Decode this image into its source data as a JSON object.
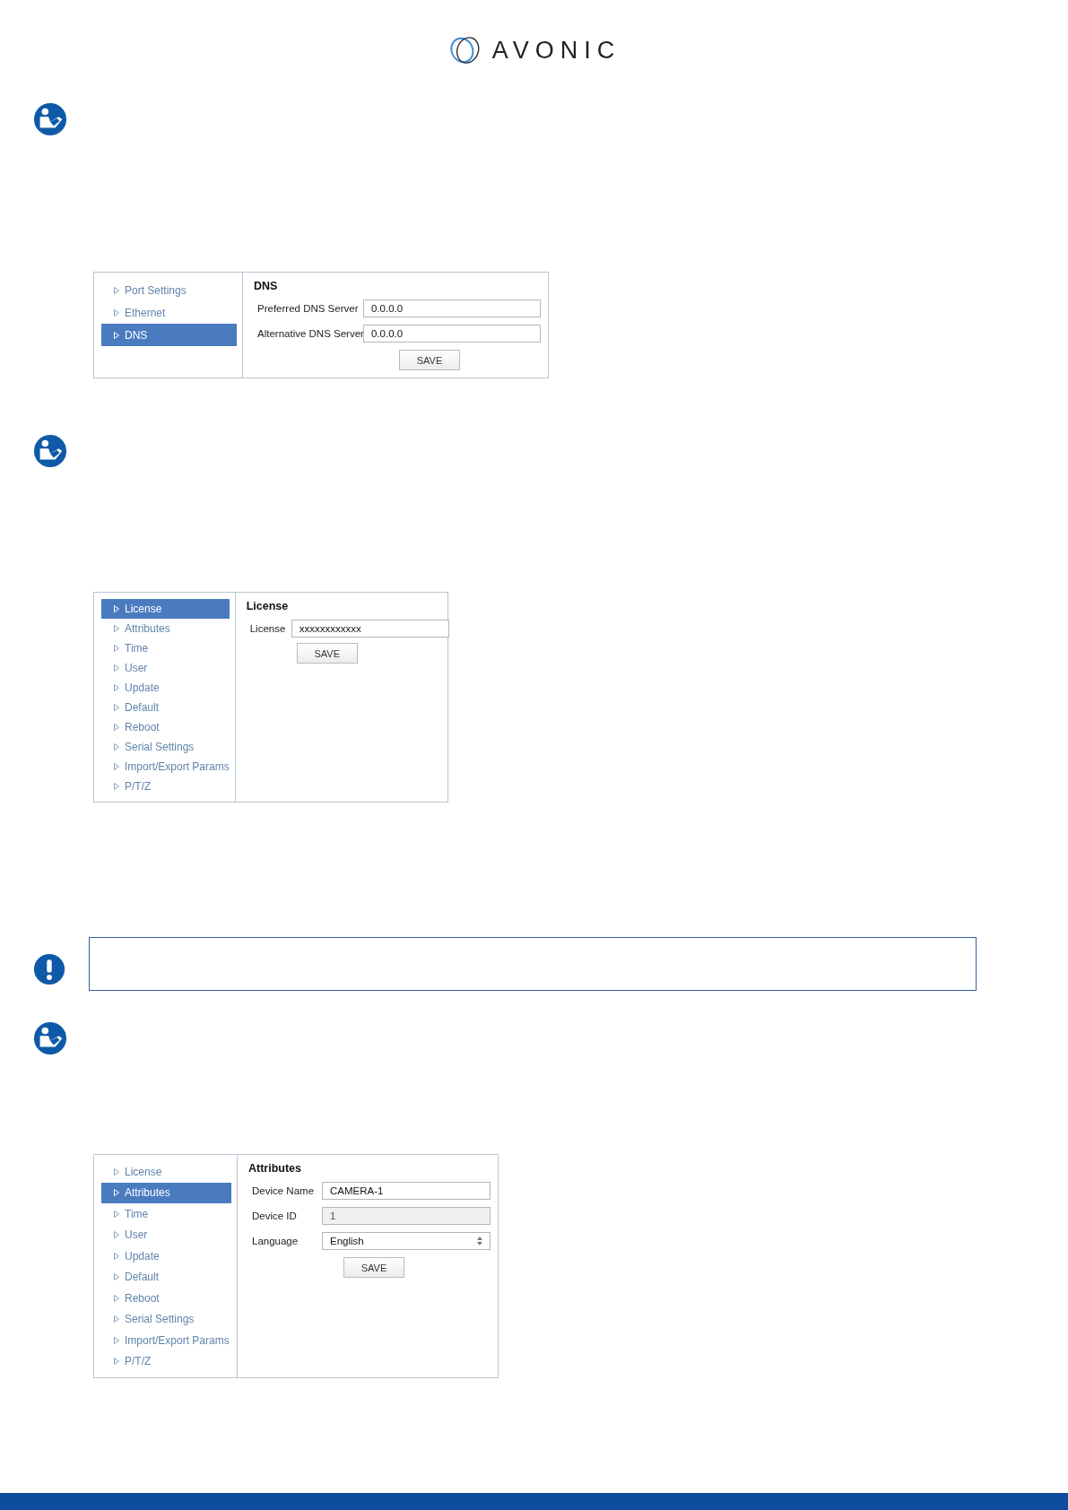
{
  "logo": {
    "text": "AVONIC"
  },
  "panels": [
    {
      "sidebar": [
        {
          "label": "Port Settings",
          "selected": false
        },
        {
          "label": "Ethernet",
          "selected": false
        },
        {
          "label": "DNS",
          "selected": true
        }
      ],
      "title": "DNS",
      "fields": [
        {
          "kind": "text",
          "label": "Preferred DNS Server",
          "value": "0.0.0.0"
        },
        {
          "kind": "text",
          "label": "Alternative DNS Server",
          "value": "0.0.0.0"
        }
      ],
      "button": "SAVE"
    },
    {
      "sidebar": [
        {
          "label": "License",
          "selected": true
        },
        {
          "label": "Attributes",
          "selected": false
        },
        {
          "label": "Time",
          "selected": false
        },
        {
          "label": "User",
          "selected": false
        },
        {
          "label": "Update",
          "selected": false
        },
        {
          "label": "Default",
          "selected": false
        },
        {
          "label": "Reboot",
          "selected": false
        },
        {
          "label": "Serial Settings",
          "selected": false
        },
        {
          "label": "Import/Export Params",
          "selected": false
        },
        {
          "label": "P/T/Z",
          "selected": false
        }
      ],
      "title": "License",
      "fields": [
        {
          "kind": "text",
          "label": "License",
          "value": "xxxxxxxxxxxx"
        }
      ],
      "button": "SAVE"
    },
    {
      "sidebar": [
        {
          "label": "License",
          "selected": false
        },
        {
          "label": "Attributes",
          "selected": true
        },
        {
          "label": "Time",
          "selected": false
        },
        {
          "label": "User",
          "selected": false
        },
        {
          "label": "Update",
          "selected": false
        },
        {
          "label": "Default",
          "selected": false
        },
        {
          "label": "Reboot",
          "selected": false
        },
        {
          "label": "Serial Settings",
          "selected": false
        },
        {
          "label": "Import/Export Params",
          "selected": false
        },
        {
          "label": "P/T/Z",
          "selected": false
        }
      ],
      "title": "Attributes",
      "fields": [
        {
          "kind": "text",
          "label": "Device Name",
          "value": "CAMERA-1"
        },
        {
          "kind": "readonly",
          "label": "Device ID",
          "value": "1"
        },
        {
          "kind": "select",
          "label": "Language",
          "value": "English"
        }
      ],
      "button": "SAVE"
    }
  ]
}
